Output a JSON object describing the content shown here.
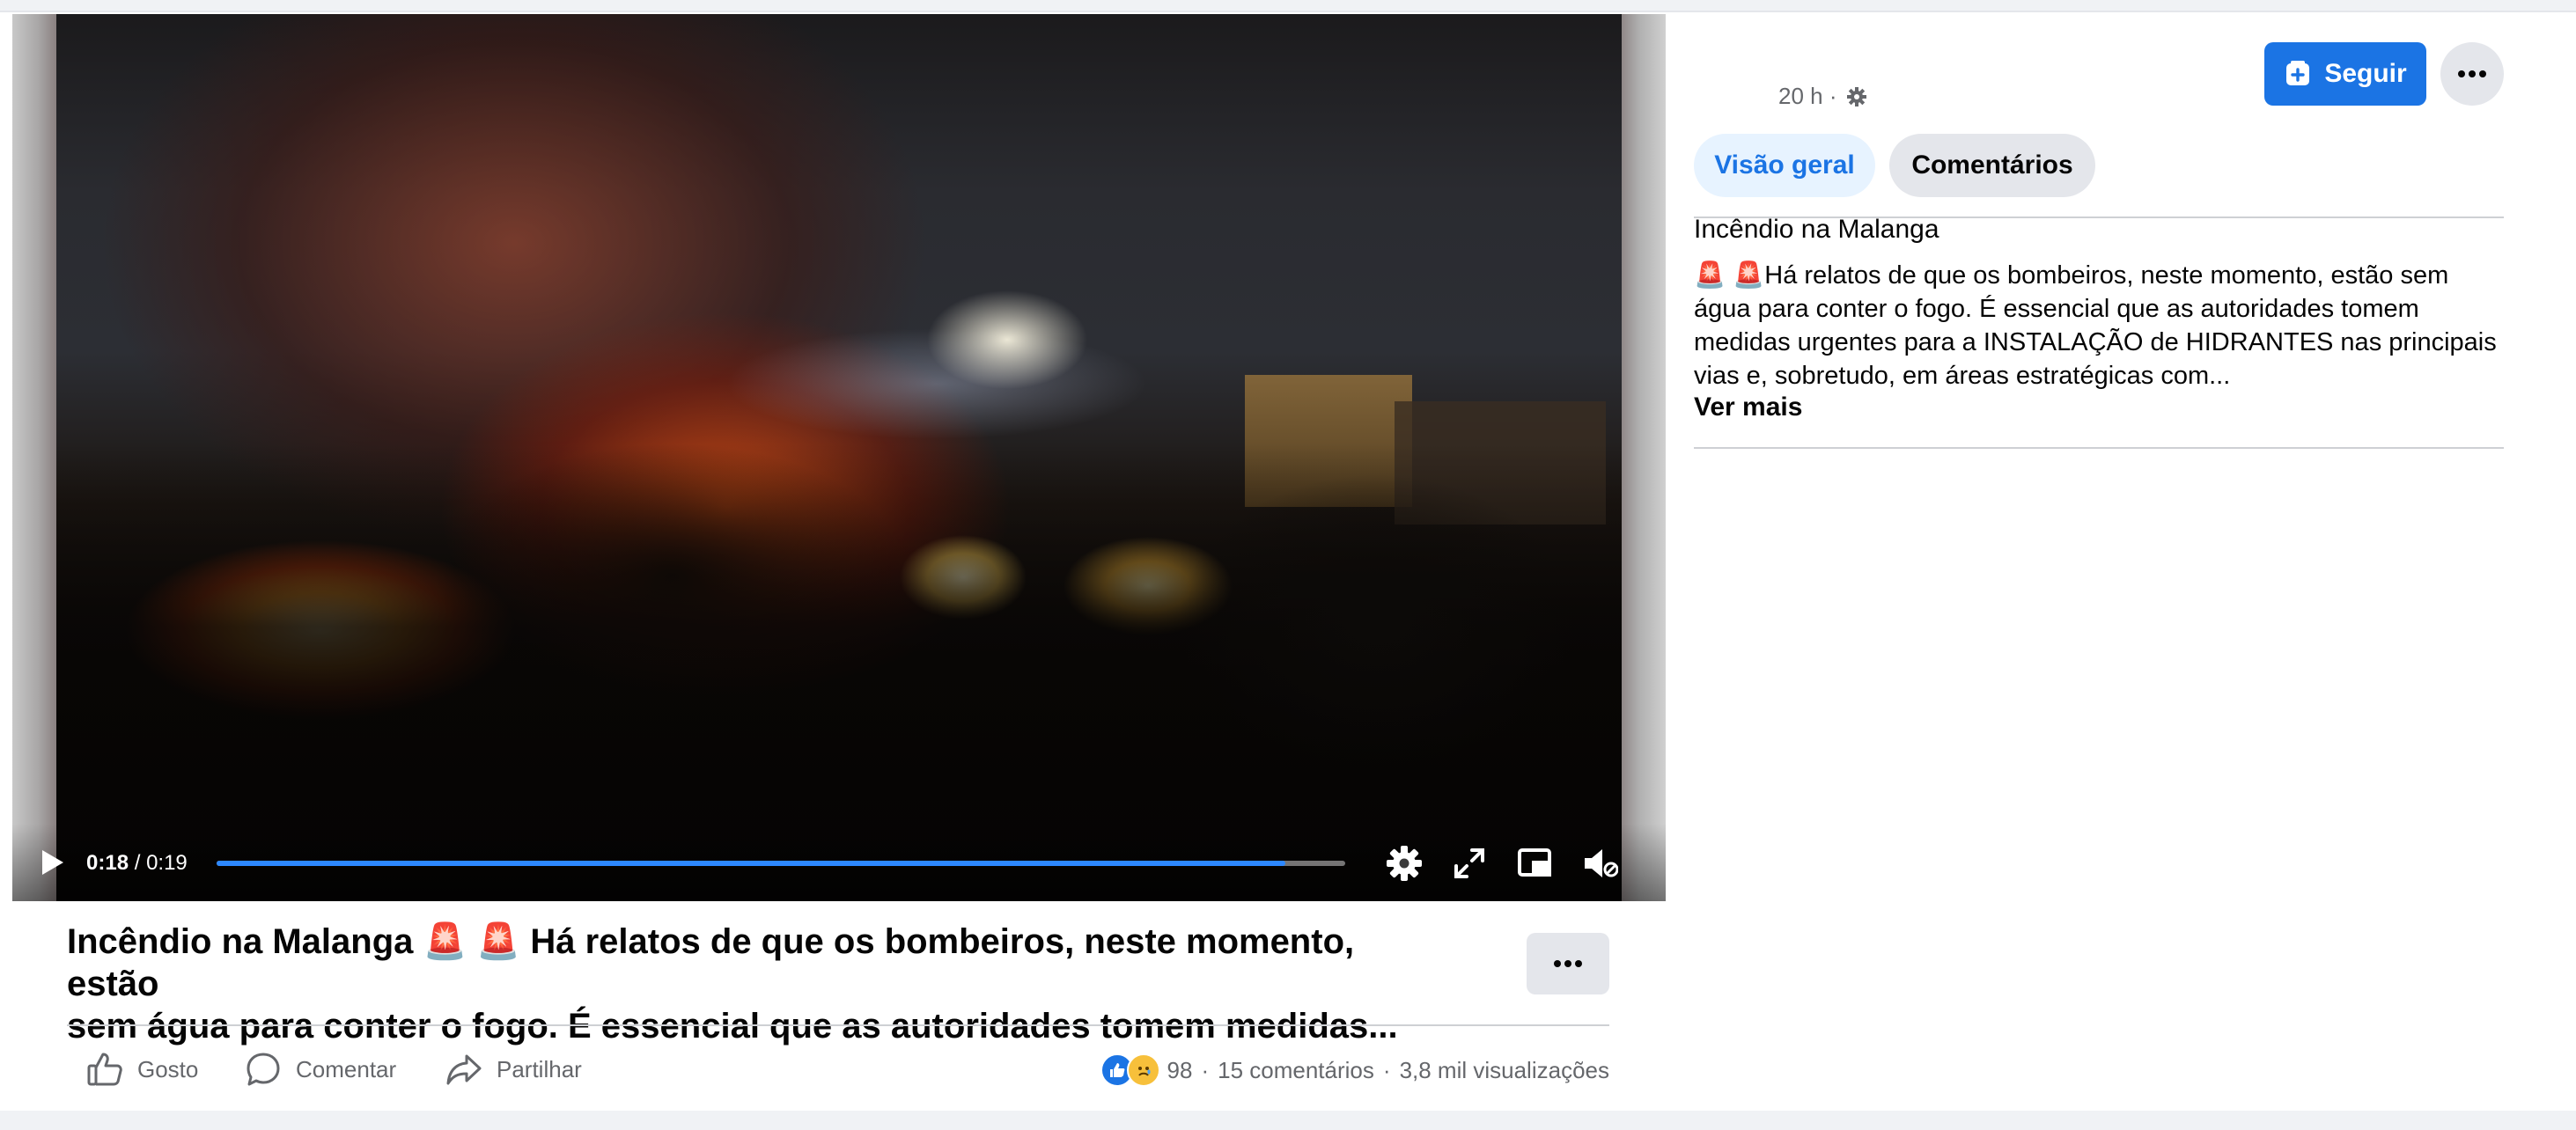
{
  "video": {
    "time_current": "0:18",
    "time_separator": " / ",
    "time_total": "0:19",
    "progress_fraction": 0.947,
    "accent_color": "#2d88ff"
  },
  "post": {
    "caption_line1": "Incêndio na Malanga 🚨 🚨 Há relatos de que os bombeiros, neste momento, estão",
    "caption_line2": "sem água para conter o fogo. É essencial que as autoridades tomem medidas...",
    "actions": {
      "like": "Gosto",
      "comment": "Comentar",
      "share": "Partilhar"
    },
    "stats": {
      "reactions_count": "98",
      "separator": "·",
      "comments": "15 comentários",
      "views": "3,8 mil visualizações"
    }
  },
  "sidebar": {
    "time": "20 h ·",
    "follow_label": "Seguir",
    "tabs": [
      {
        "label": "Visão geral",
        "active": true
      },
      {
        "label": "Comentários",
        "active": false
      }
    ],
    "title": "Incêndio na Malanga",
    "body": "🚨 🚨Há relatos de que os bombeiros, neste momento, estão sem água para conter o fogo. É essencial que as autoridades tomem medidas urgentes para a INSTALAÇÃO de HIDRANTES nas principais vias e, sobretudo, em áreas estratégicas com...",
    "see_more": "Ver mais"
  },
  "colors": {
    "primary_blue": "#1b74e4",
    "secondary_gray": "#65676b",
    "button_gray": "#e4e6eb"
  },
  "icons": [
    "play-icon",
    "settings-gear-icon",
    "fullscreen-icon",
    "picture-in-picture-icon",
    "volume-muted-icon",
    "more-dots-icon",
    "thumbs-up-icon",
    "comment-bubble-icon",
    "share-arrow-icon",
    "follow-plus-icon",
    "privacy-gear-icon",
    "like-reaction-icon",
    "sad-reaction-icon"
  ]
}
